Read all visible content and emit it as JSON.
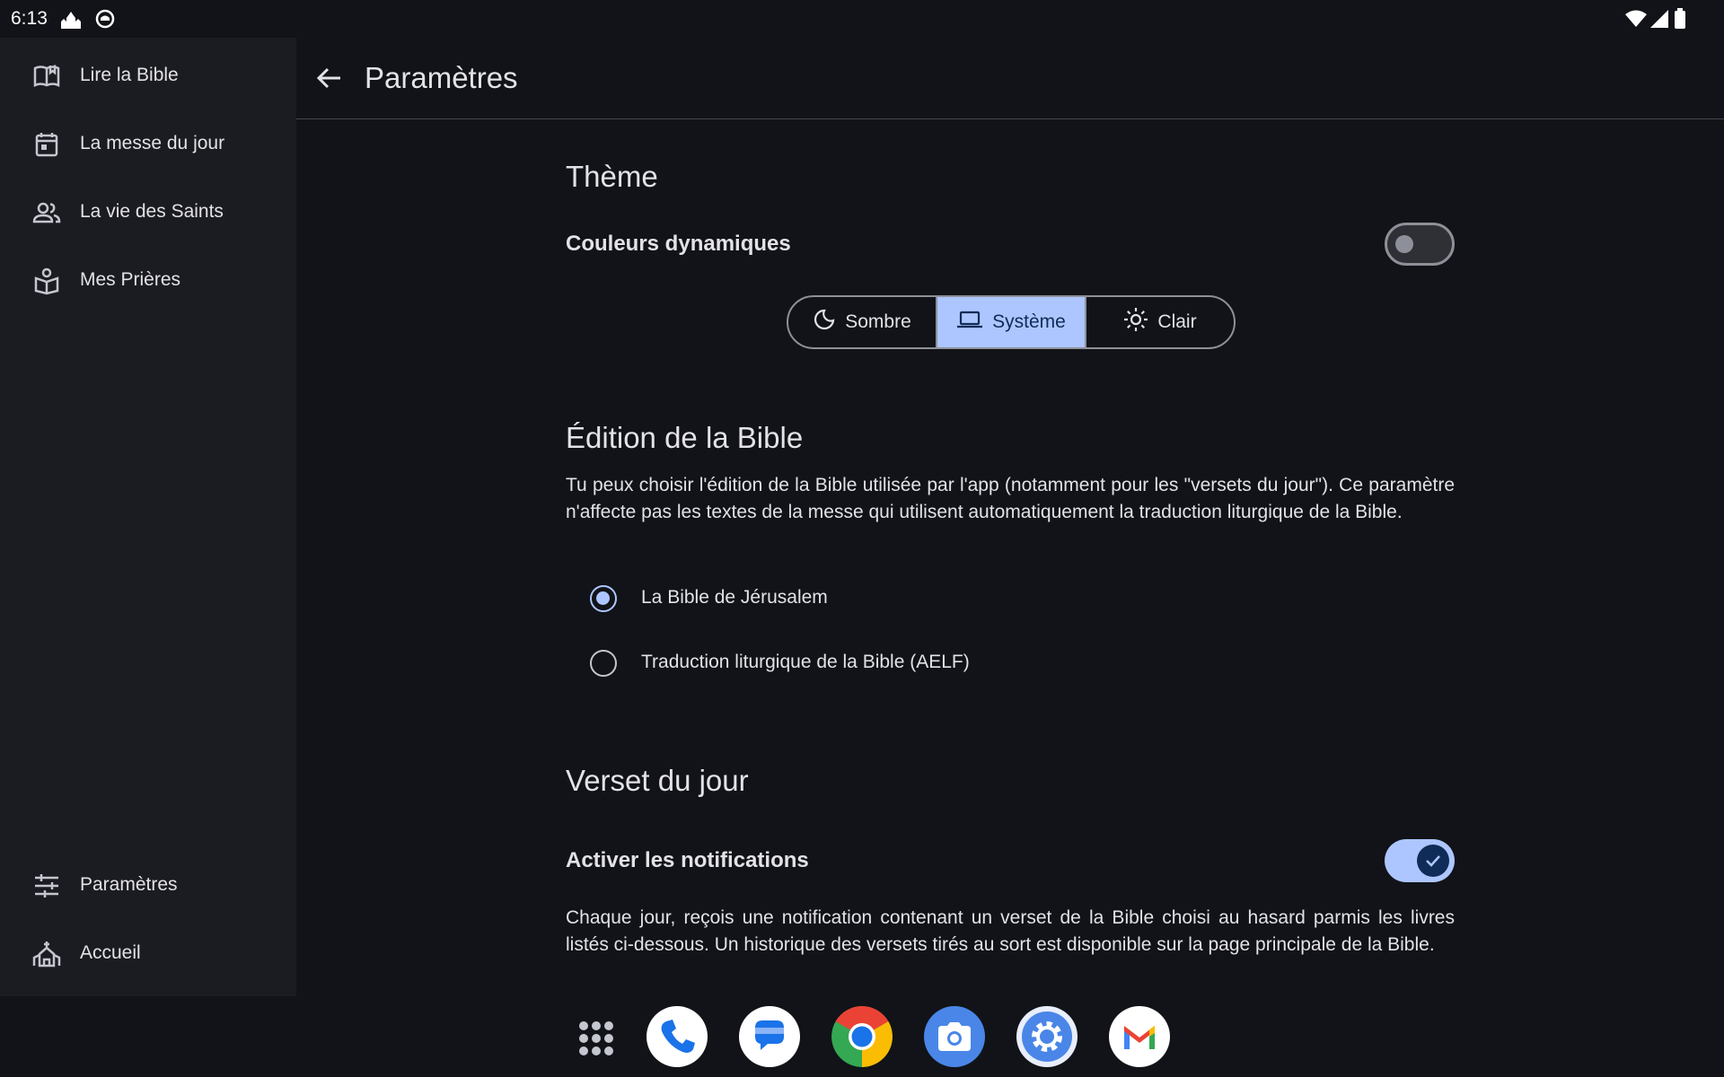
{
  "status_bar": {
    "time": "6:13"
  },
  "sidebar": {
    "items": [
      {
        "label": "Lire la Bible",
        "icon": "book-open-icon"
      },
      {
        "label": "La messe du jour",
        "icon": "calendar-icon"
      },
      {
        "label": "La vie des Saints",
        "icon": "people-icon"
      },
      {
        "label": "Mes Prières",
        "icon": "prayer-icon"
      }
    ],
    "bottom_items": [
      {
        "label": "Paramètres",
        "icon": "sliders-icon"
      },
      {
        "label": "Accueil",
        "icon": "church-icon"
      }
    ]
  },
  "header": {
    "title": "Paramètres"
  },
  "theme": {
    "heading": "Thème",
    "dynamic_colors_label": "Couleurs dynamiques",
    "dynamic_colors_enabled": false,
    "modes": [
      {
        "label": "Sombre",
        "icon": "moon-icon"
      },
      {
        "label": "Système",
        "icon": "laptop-icon"
      },
      {
        "label": "Clair",
        "icon": "sun-icon"
      }
    ],
    "selected_mode": "Système"
  },
  "bible_edition": {
    "heading": "Édition de la Bible",
    "description": "Tu peux choisir l'édition de la Bible utilisée par l'app (notamment pour les \"versets du jour\"). Ce paramètre n'affecte pas les textes de la messe qui utilisent automatiquement la traduction liturgique de la Bible.",
    "options": [
      "La Bible de Jérusalem",
      "Traduction liturgique de la Bible (AELF)"
    ],
    "selected": "La Bible de Jérusalem"
  },
  "verse_of_day": {
    "heading": "Verset du jour",
    "notifications_label": "Activer les notifications",
    "notifications_enabled": true,
    "description": "Chaque jour, reçois une notification contenant un verset de la Bible choisi au hasard parmis les livres listés ci-dessous. Un historique des versets tirés au sort est disponible sur la page principale de la Bible."
  },
  "dock": {
    "apps": [
      "app-drawer-icon",
      "phone-icon",
      "messages-icon",
      "chrome-icon",
      "camera-icon",
      "settings-icon",
      "gmail-icon"
    ]
  },
  "colors": {
    "background": "#111318",
    "sidebar": "#1b1c21",
    "accent": "#adc6ff",
    "accent_on": "#0f2b57"
  }
}
